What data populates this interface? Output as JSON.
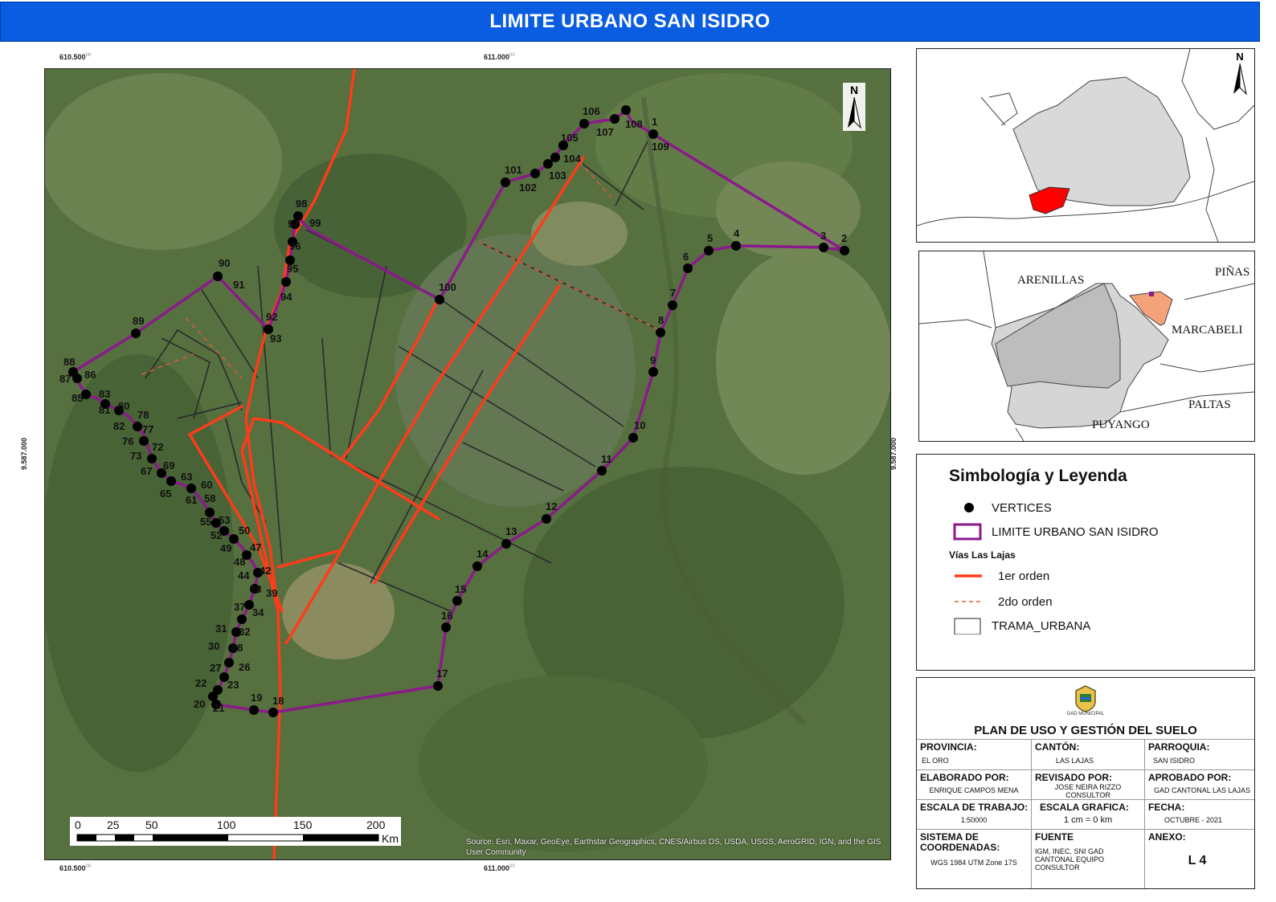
{
  "title": "LIMITE URBANO SAN ISIDRO",
  "coordinates": {
    "x_left": "610.500",
    "x_right": "611.000",
    "y_mid": "9.587.000",
    "superscript": "00"
  },
  "north_label": "N",
  "scale_bar": {
    "ticks": [
      "0",
      "25",
      "50",
      "100",
      "150",
      "200"
    ],
    "unit": "Km"
  },
  "source_credit": "Source: Esri, Maxar, GeoEye, Earthstar Geographics, CNES/Airbus DS, USDA, USGS, AeroGRID, IGN, and the GIS User Community",
  "vertex_labels": [
    "1",
    "2",
    "3",
    "4",
    "5",
    "6",
    "7",
    "8",
    "9",
    "10",
    "11",
    "12",
    "13",
    "14",
    "15",
    "16",
    "17",
    "18",
    "19",
    "20",
    "21",
    "22",
    "23",
    "26",
    "27",
    "28",
    "30",
    "31",
    "32",
    "34",
    "37",
    "38",
    "39",
    "42",
    "44",
    "47",
    "48",
    "49",
    "50",
    "52",
    "53",
    "55",
    "58",
    "60",
    "61",
    "63",
    "65",
    "67",
    "69",
    "72",
    "73",
    "76",
    "77",
    "78",
    "80",
    "81",
    "82",
    "83",
    "85",
    "86",
    "87",
    "88",
    "89",
    "90",
    "91",
    "92",
    "93",
    "94",
    "95",
    "96",
    "97",
    "98",
    "99",
    "100",
    "101",
    "102",
    "103",
    "104",
    "105",
    "106",
    "107",
    "108",
    "109"
  ],
  "locator_map": {
    "north_label": "N",
    "cantons": [
      "ARENILLAS",
      "PIÑAS",
      "MARCABELI",
      "PALTAS",
      "PUYANGO"
    ]
  },
  "legend": {
    "title": "Simbología y Leyenda",
    "vertices": "VERTICES",
    "limite": "LIMITE URBANO SAN ISIDRO",
    "vias_title": "Vías Las Lajas",
    "primer_orden": "1er orden",
    "segundo_orden": "2do orden",
    "trama": "TRAMA_URBANA"
  },
  "colors": {
    "title_bar": "#0a5de0",
    "boundary": "#8b1a8b",
    "road_primary": "#ff3b1a",
    "road_secondary": "#e05a3a",
    "province_highlight": "#ff0000",
    "canton_highlight": "#f4a27a"
  },
  "title_block": {
    "plan_title": "PLAN DE USO Y GESTIÓN DEL SUELO",
    "logo_text": "GAD MUNICIPAL",
    "provincia_label": "PROVINCIA:",
    "provincia_value": "EL ORO",
    "canton_label": "CANTÓN:",
    "canton_value": "LAS LAJAS",
    "parroquia_label": "PARROQUIA:",
    "parroquia_value": "SAN ISIDRO",
    "elaborado_label": "ELABORADO POR:",
    "elaborado_value": "ENRIQUE CAMPOS MENA",
    "revisado_label": "REVISADO POR:",
    "revisado_value": "JOSE NEIRA RIZZO CONSULTOR",
    "aprobado_label": "APROBADO POR:",
    "aprobado_value": "GAD CANTONAL LAS LAJAS",
    "escala_trabajo_label": "ESCALA DE TRABAJO:",
    "escala_trabajo_value": "1:50000",
    "escala_grafica_label": "ESCALA GRAFICA:",
    "escala_grafica_value": "1 cm = 0 km",
    "fecha_label": "FECHA:",
    "fecha_value": "OCTUBRE - 2021",
    "sistema_label": "SISTEMA DE COORDENADAS:",
    "sistema_value": "WGS 1984 UTM Zone 17S",
    "fuente_label": "FUENTE",
    "fuente_value": "IGM, INEC, SNI GAD CANTONAL EQUIPO CONSULTOR",
    "anexo_label": "ANEXO:",
    "anexo_value": "L 4"
  }
}
